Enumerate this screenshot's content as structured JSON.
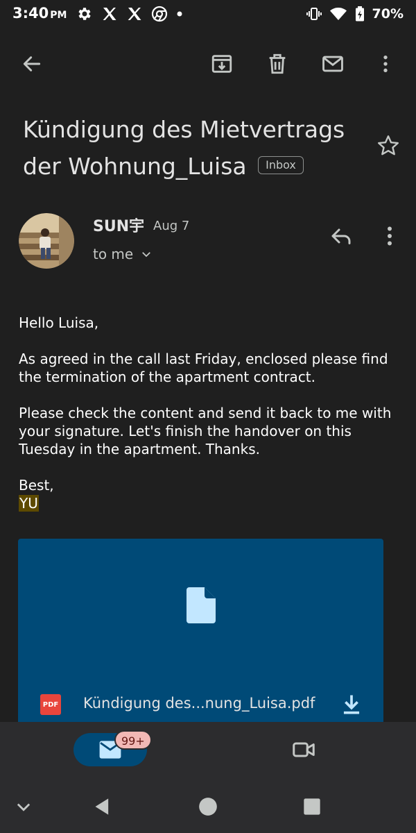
{
  "status_bar": {
    "time": "3:40",
    "ampm": "PM",
    "battery": "70%",
    "icons_left": [
      "settings-icon",
      "x-icon",
      "x-icon",
      "chrome-icon",
      "dot-icon"
    ],
    "icons_right": [
      "vibrate-icon",
      "wifi-icon",
      "battery-icon"
    ]
  },
  "toolbar": {
    "back": "back-arrow-icon",
    "archive": "archive-icon",
    "delete": "trash-icon",
    "mark_unread": "mail-icon",
    "more": "more-vert-icon"
  },
  "email": {
    "subject": "Kündigung des Mietvertrags der Wohnung_Luisa",
    "label_chip": "Inbox",
    "sender_name": "SUN宇",
    "date": "Aug 7",
    "recipient": "to me",
    "body": {
      "greeting": "Hello Luisa,",
      "para1": "As agreed in the call last Friday, enclosed please find the termination of the apartment contract.",
      "para2": "Please check the content and send it back to me with your signature. Let's finish the handover on this Tuesday in the apartment. Thanks.",
      "closing": "Best,",
      "signature": "YU"
    },
    "attachment": {
      "type_badge": "PDF",
      "filename": "Kündigung des...nung_Luisa.pdf"
    }
  },
  "bottom_nav": {
    "mail_badge": "99+"
  },
  "colors": {
    "background": "#1f1f1f",
    "attachment_bg": "#004a77",
    "nav_active": "#004a77",
    "badge": "#f2b8b5",
    "highlight": "#5d4a00"
  }
}
